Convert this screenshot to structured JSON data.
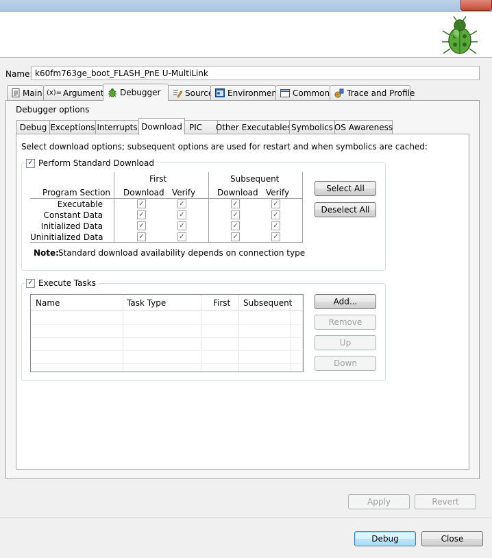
{
  "name": {
    "label": "Name:",
    "value": "k60fm763ge_boot_FLASH_PnE U-MultiLink"
  },
  "top_tabs": [
    {
      "label": "Main",
      "icon": "main-tab-icon"
    },
    {
      "label": "Arguments",
      "icon": "arguments-icon"
    },
    {
      "label": "Debugger",
      "icon": "debugger-bug-icon",
      "active": true
    },
    {
      "label": "Source",
      "icon": "source-icon"
    },
    {
      "label": "Environment",
      "icon": "environment-icon"
    },
    {
      "label": "Common",
      "icon": "common-icon"
    },
    {
      "label": "Trace and Profile",
      "icon": "trace-profile-icon"
    }
  ],
  "debugger_options_label": "Debugger options",
  "sub_tabs": [
    "Debug",
    "Exceptions",
    "Interrupts",
    "Download",
    "PIC",
    "Other Executables",
    "Symbolics",
    "OS Awareness"
  ],
  "active_sub_tab": "Download",
  "download": {
    "instructions": "Select download options; subsequent options are used for restart and when symbolics are cached:",
    "perform_standard_download": {
      "label": "Perform Standard Download",
      "checked": true
    },
    "table": {
      "first_label": "First",
      "subsequent_label": "Subsequent",
      "program_section_label": "Program Section",
      "download_label": "Download",
      "verify_label": "Verify",
      "rows": [
        {
          "label": "Executable"
        },
        {
          "label": "Constant Data"
        },
        {
          "label": "Initialized Data"
        },
        {
          "label": "Uninitialized Data"
        }
      ]
    },
    "select_all": "Select All",
    "deselect_all": "Deselect All",
    "note_bold": "Note:",
    "note_text": "Standard download availability depends on connection type"
  },
  "tasks": {
    "execute_tasks": {
      "label": "Execute Tasks",
      "checked": true
    },
    "columns": [
      "Name",
      "Task Type",
      "First",
      "Subsequent"
    ],
    "add": "Add...",
    "remove": "Remove",
    "up": "Up",
    "down": "Down"
  },
  "apply": "Apply",
  "revert": "Revert",
  "debug": "Debug",
  "close": "Close"
}
